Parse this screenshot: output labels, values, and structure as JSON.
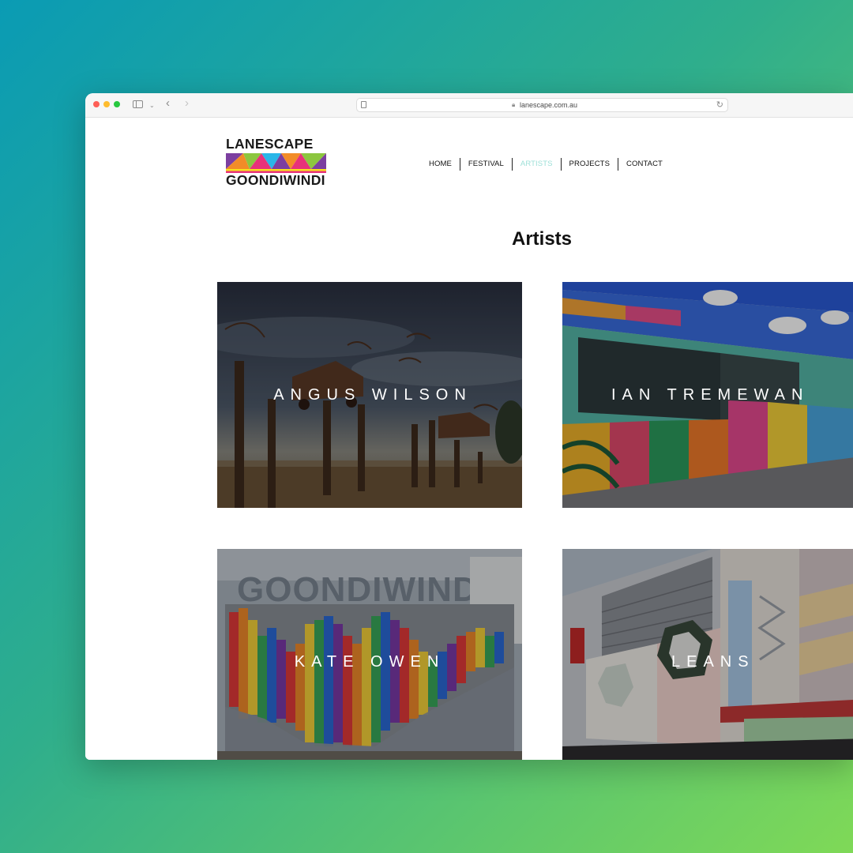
{
  "browser": {
    "url": "lanescape.com.au"
  },
  "site": {
    "logo_top": "LANESCAPE",
    "logo_bottom": "GOONDIWINDI"
  },
  "nav": {
    "items": [
      {
        "label": "HOME"
      },
      {
        "label": "FESTIVAL"
      },
      {
        "label": "ARTISTS"
      },
      {
        "label": "PROJECTS"
      },
      {
        "label": "CONTACT"
      }
    ],
    "active": "ARTISTS"
  },
  "main": {
    "title": "Artists",
    "artists": [
      {
        "name": "ANGUS WILSON"
      },
      {
        "name": "IAN TREMEWAN"
      },
      {
        "name": "KATE OWEN"
      },
      {
        "name": "LEANS"
      }
    ],
    "wall_text": "GOONDIWINDI"
  },
  "colors": {
    "active_nav": "#9ee0d8",
    "background_start": "#0a9bb4",
    "background_end": "#7fd957"
  }
}
